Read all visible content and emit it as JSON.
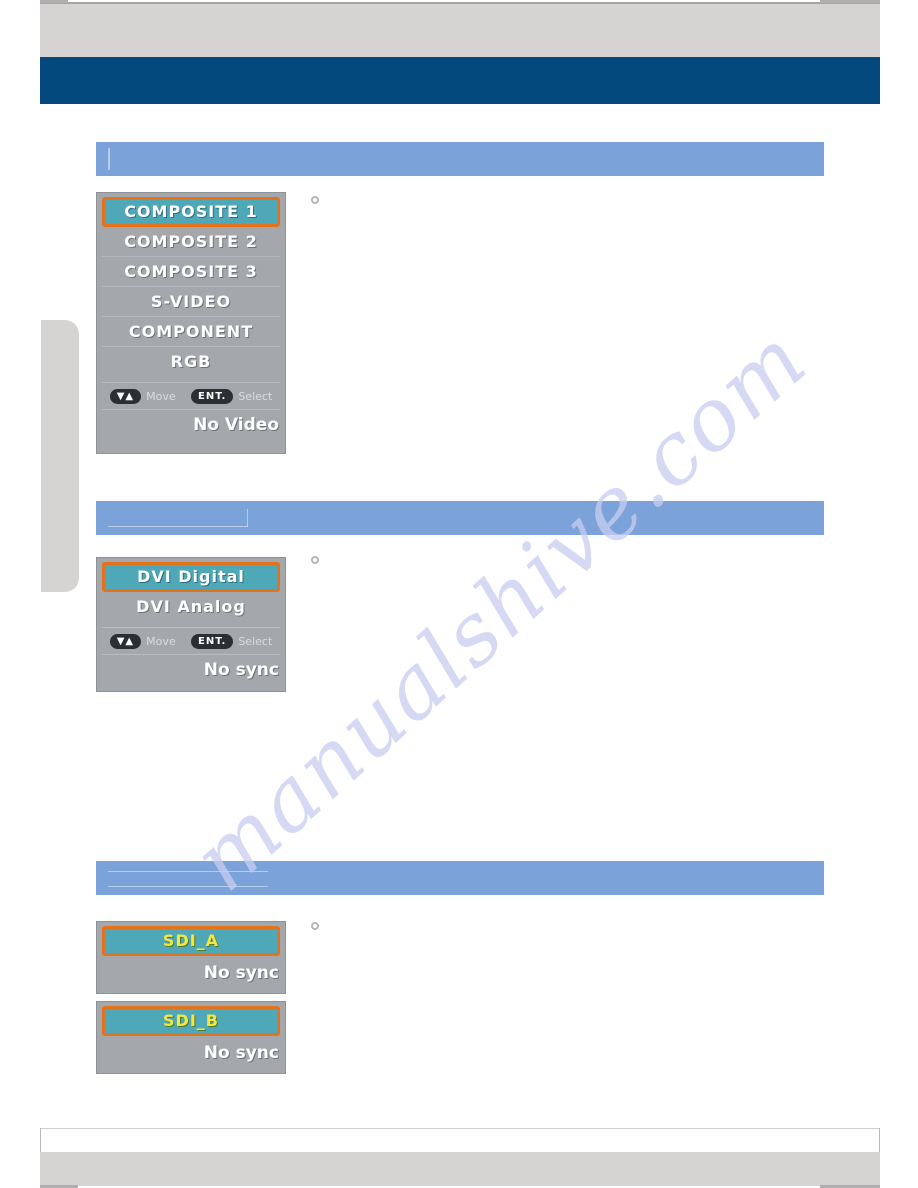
{
  "header": {
    "title": "",
    "side_tab_label": ""
  },
  "watermark": {
    "text": "manualshive.com"
  },
  "sections": [
    {
      "heading": "",
      "bullet_text": "",
      "osd": {
        "items": [
          {
            "label": "COMPOSITE 1",
            "selected": true
          },
          {
            "label": "COMPOSITE 2",
            "selected": false
          },
          {
            "label": "COMPOSITE 3",
            "selected": false
          },
          {
            "label": "S-VIDEO",
            "selected": false
          },
          {
            "label": "COMPONENT",
            "selected": false
          },
          {
            "label": "RGB",
            "selected": false
          }
        ],
        "hint_move_key": "▼▲",
        "hint_move_label": "Move",
        "hint_enter_key": "ENT.",
        "hint_enter_label": "Select",
        "status": "No Video"
      }
    },
    {
      "heading": "",
      "bullet_text": "",
      "osd": {
        "items": [
          {
            "label": "DVI Digital",
            "selected": true
          },
          {
            "label": "DVI Analog",
            "selected": false
          }
        ],
        "hint_move_key": "▼▲",
        "hint_move_label": "Move",
        "hint_enter_key": "ENT.",
        "hint_enter_label": "Select",
        "status": "No sync"
      }
    },
    {
      "heading": "",
      "bullet_text": "",
      "osd_a": {
        "items": [
          {
            "label": "SDI_A",
            "selected": true
          }
        ],
        "status": "No sync"
      },
      "osd_b": {
        "items": [
          {
            "label": "SDI_B",
            "selected": true
          }
        ],
        "status": "No sync"
      }
    }
  ],
  "footer": {
    "left_text": "",
    "right_text": ""
  },
  "colors": {
    "header_band": "#04497e",
    "header_gray": "#d6d4d3",
    "section_bar": "#7ba3d9",
    "osd_background": "#a4a8ad",
    "osd_highlight": "#4fa8b8",
    "osd_highlight_border": "#e2721b",
    "osd_selected_text_yellow": "#f5e642",
    "watermark": "#c9cdf0"
  }
}
